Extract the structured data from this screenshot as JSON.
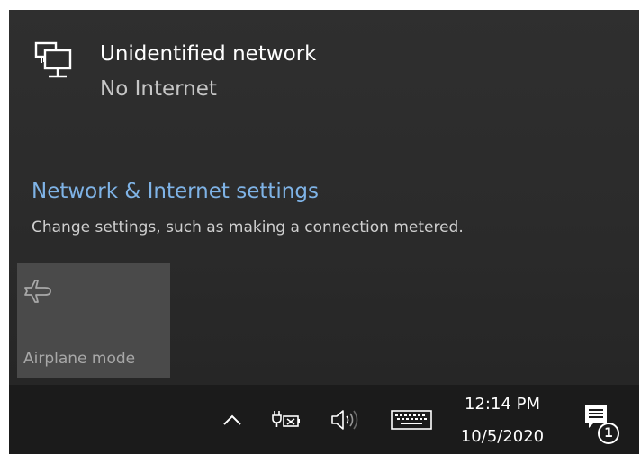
{
  "network": {
    "icon": "wired-network-icon",
    "name": "Unidentified network",
    "status": "No Internet"
  },
  "settings": {
    "link_label": "Network & Internet settings",
    "description": "Change settings, such as making a connection metered."
  },
  "quick_actions": [
    {
      "icon": "airplane-icon",
      "label": "Airplane mode"
    }
  ],
  "taskbar": {
    "tray_icons": [
      "chevron-up-icon",
      "battery-charging-icon",
      "volume-icon",
      "touch-keyboard-icon"
    ],
    "time": "12:14 PM",
    "date": "10/5/2020",
    "notification_count": "1",
    "notification_icon": "action-center-icon"
  },
  "colors": {
    "flyout_bg": "#2b2b2b",
    "link": "#7fb3e6",
    "taskbar_bg": "#1b1b1b",
    "tile_bg": "#4a4a4a"
  }
}
